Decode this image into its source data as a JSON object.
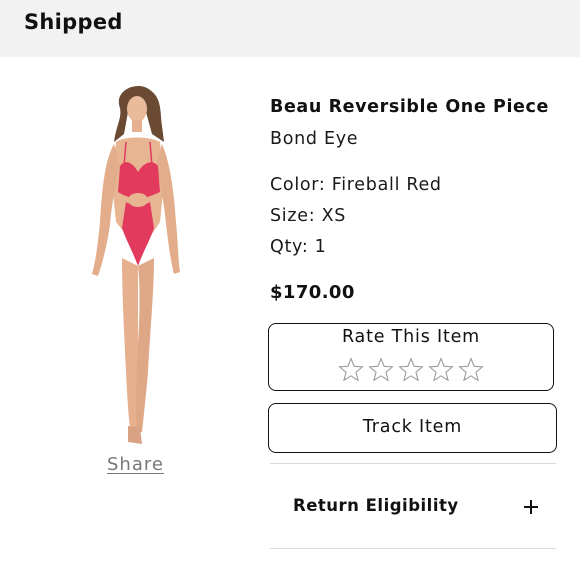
{
  "header": {
    "title": "Shipped"
  },
  "product": {
    "image_alt": "model wearing red patterned one piece swimsuit",
    "share_label": "Share",
    "name": "Beau Reversible One Piece",
    "brand": "Bond Eye",
    "color_line": "Color: Fireball Red",
    "size_line": "Size: XS",
    "qty_line": "Qty: 1",
    "price": "$170.00"
  },
  "rating": {
    "label": "Rate This Item",
    "max_stars": 5,
    "current": 0,
    "star_icon": "star-outline-icon"
  },
  "actions": {
    "track_label": "Track Item"
  },
  "return_section": {
    "label": "Return Eligibility",
    "expand_icon": "plus-icon"
  },
  "colors": {
    "header_bg": "#f2f2f2",
    "swimsuit": "#e23a5c",
    "star_outline": "#9a9a9a",
    "divider": "#d9d9d9"
  }
}
